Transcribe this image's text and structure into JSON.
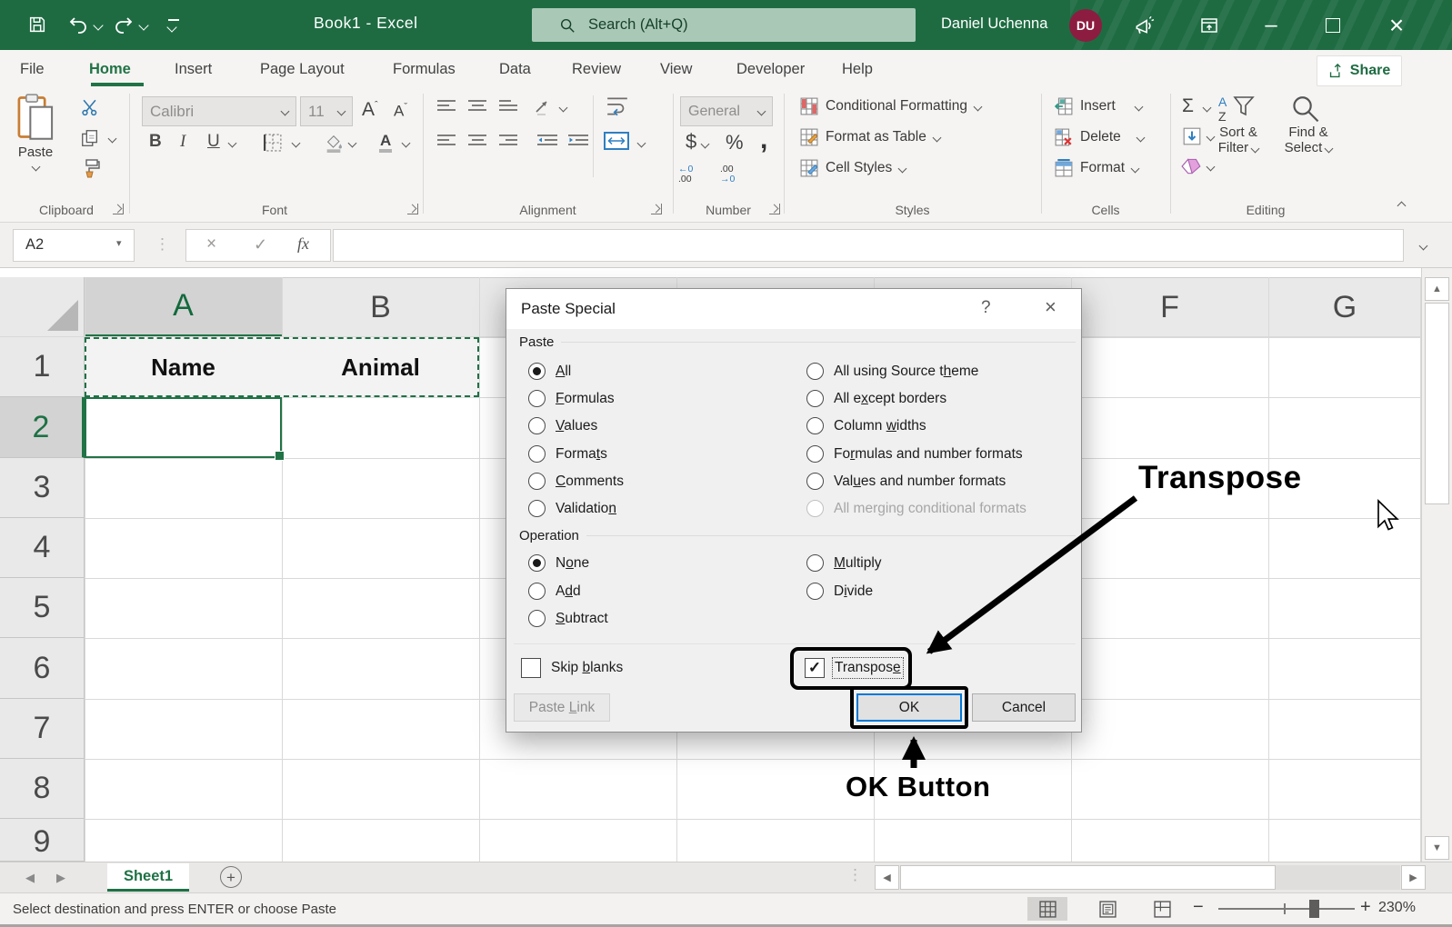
{
  "titlebar": {
    "title": "Book1 - Excel",
    "search_placeholder": "Search (Alt+Q)",
    "user_name": "Daniel Uchenna",
    "user_initials": "DU"
  },
  "tabs": [
    "File",
    "Home",
    "Insert",
    "Page Layout",
    "Formulas",
    "Data",
    "Review",
    "View",
    "Developer",
    "Help"
  ],
  "share_label": "Share",
  "ribbon": {
    "paste": "Paste",
    "font_name": "Calibri",
    "font_size": "11",
    "number_format": "General",
    "conditional_formatting": "Conditional Formatting",
    "format_as_table": "Format as Table",
    "cell_styles": "Cell Styles",
    "insert": "Insert",
    "delete": "Delete",
    "format": "Format",
    "sort1": "Sort &",
    "sort2": "Filter",
    "find1": "Find &",
    "find2": "Select",
    "groups": {
      "clipboard": "Clipboard",
      "font": "Font",
      "alignment": "Alignment",
      "number": "Number",
      "styles": "Styles",
      "cells": "Cells",
      "editing": "Editing"
    }
  },
  "formula_bar": {
    "name_box": "A2",
    "formula": ""
  },
  "grid": {
    "columns": {
      "a": "A",
      "b": "B",
      "f": "F",
      "g": "G"
    },
    "rows": [
      "1",
      "2",
      "3",
      "4",
      "5",
      "6",
      "7",
      "8",
      "9"
    ],
    "cells": {
      "a1": "Name",
      "b1": "Animal"
    }
  },
  "dialog": {
    "title": "Paste Special",
    "paste_label": "Paste",
    "operation_label": "Operation",
    "paste_left": [
      {
        "pre": "",
        "key": "A",
        "post": "ll"
      },
      {
        "pre": "",
        "key": "F",
        "post": "ormulas"
      },
      {
        "pre": "",
        "key": "V",
        "post": "alues"
      },
      {
        "pre": "Forma",
        "key": "t",
        "post": "s"
      },
      {
        "pre": "",
        "key": "C",
        "post": "omments"
      },
      {
        "pre": "Validatio",
        "key": "n",
        "post": ""
      }
    ],
    "paste_right": [
      {
        "pre": "All using Source t",
        "key": "h",
        "post": "eme"
      },
      {
        "pre": "All e",
        "key": "x",
        "post": "cept borders"
      },
      {
        "pre": "Column ",
        "key": "w",
        "post": "idths"
      },
      {
        "pre": "Fo",
        "key": "r",
        "post": "mulas and number formats"
      },
      {
        "pre": "Val",
        "key": "u",
        "post": "es and number formats"
      },
      {
        "pre": "All merging conditional formats",
        "key": "",
        "post": ""
      }
    ],
    "op_left": [
      {
        "pre": "N",
        "key": "o",
        "post": "ne"
      },
      {
        "pre": "A",
        "key": "d",
        "post": "d"
      },
      {
        "pre": "",
        "key": "S",
        "post": "ubtract"
      }
    ],
    "op_right": [
      {
        "pre": "",
        "key": "M",
        "post": "ultiply"
      },
      {
        "pre": "D",
        "key": "i",
        "post": "vide"
      }
    ],
    "skip_blanks": {
      "pre": "Skip ",
      "key": "b",
      "post": "lanks"
    },
    "transpose": {
      "pre": "Transpos",
      "key": "e",
      "post": ""
    },
    "paste_link": {
      "pre": "Paste ",
      "key": "L",
      "post": "ink"
    },
    "ok": "OK",
    "cancel": "Cancel"
  },
  "annotations": {
    "transpose": "Transpose",
    "ok": "OK Button"
  },
  "sheet": {
    "name": "Sheet1"
  },
  "status": {
    "message": "Select destination and press ENTER or choose Paste",
    "zoom": "230%"
  },
  "icons": {
    "help": "?",
    "close": "×",
    "minimize": "–",
    "maximize": "",
    "cancel_x": "×",
    "check": "✓",
    "fx": "fx",
    "sigma": "Σ",
    "dollar": "$",
    "percent": "%",
    "comma": ",",
    "bold": "B",
    "italic": "I",
    "underline": "U",
    "grow": "A",
    "shrink": "A",
    "font_color": "A",
    "az_a": "A",
    "az_z": "Z",
    "dec_l1": "←0",
    "dec_l2": ".00",
    "dec_r1": ".00",
    "dec_r2": "→0",
    "namebox_arrow": "▾",
    "up": "▲",
    "down": "▼",
    "left": "◀",
    "right": "▶",
    "plus": "+",
    "minus": "−",
    "dots": "⋮",
    "new_sheet": "+"
  }
}
